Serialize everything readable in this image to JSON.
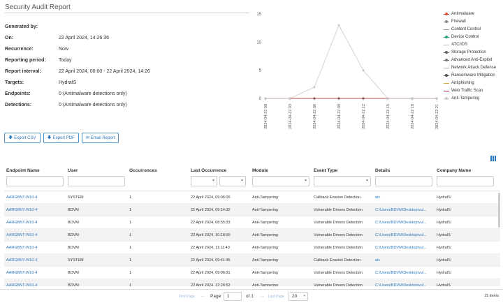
{
  "report": {
    "title": "Security Audit Report",
    "details": [
      {
        "label": "Generated by:",
        "value": ""
      },
      {
        "label": "On:",
        "value": "22 April 2024, 14:26:36"
      },
      {
        "label": "Recurrence:",
        "value": "Now"
      },
      {
        "label": "Reporting period:",
        "value": "Today"
      },
      {
        "label": "Report interval:",
        "value": "22 April 2024, 00:00 - 22 April 2024, 14:26"
      },
      {
        "label": "Targets:",
        "value": "HydraIS"
      },
      {
        "label": "Endpoints:",
        "value": "0 (Antimalware detections only)"
      },
      {
        "label": "Detections:",
        "value": "0 (Antimalware detections only)"
      }
    ]
  },
  "chart_data": {
    "type": "line",
    "x": [
      "2024-04-22 00",
      "2024-04-22 03",
      "2024-04-22 06",
      "2024-04-22 09",
      "2024-04-22 12",
      "2024-04-22 15",
      "2024-04-22 18",
      "2024-04-22 21"
    ],
    "ylim": [
      0,
      15
    ],
    "yticks": [
      0,
      5,
      10,
      15
    ],
    "grid": false,
    "legend_position": "right",
    "series": [
      {
        "name": "Antimalware",
        "color": "#e05030",
        "marker": true,
        "values": [
          0,
          0,
          0,
          0,
          0,
          0,
          0,
          0
        ]
      },
      {
        "name": "Firewall",
        "color": "#888888",
        "marker": true,
        "values": [
          0,
          0,
          0,
          0,
          0,
          0,
          0,
          0
        ]
      },
      {
        "name": "Content Control",
        "color": "#999999",
        "marker": false,
        "values": [
          0,
          0,
          0,
          0,
          0,
          0,
          0,
          0
        ]
      },
      {
        "name": "Device Control",
        "color": "#2aa070",
        "marker": true,
        "values": [
          0,
          0,
          0,
          0,
          0,
          0,
          0,
          0
        ]
      },
      {
        "name": "ATC/IDS",
        "color": "#bbbbbb",
        "marker": false,
        "values": [
          0,
          0,
          0,
          0,
          0,
          0,
          0,
          0
        ]
      },
      {
        "name": "Storage Protection",
        "color": "#666666",
        "marker": true,
        "values": [
          0,
          0,
          0,
          0,
          0,
          0,
          0,
          0
        ]
      },
      {
        "name": "Advanced Anti-Exploit",
        "color": "#777777",
        "marker": true,
        "values": [
          0,
          0,
          0,
          0,
          0,
          0,
          0,
          0
        ]
      },
      {
        "name": "Network Attack Defense",
        "color": "#aaaaaa",
        "marker": false,
        "values": [
          0,
          0,
          0,
          0,
          0,
          0,
          0,
          0
        ]
      },
      {
        "name": "Ransomware Mitigation",
        "color": "#555555",
        "marker": true,
        "values": [
          0,
          0,
          0,
          0,
          0,
          0,
          0,
          0
        ]
      },
      {
        "name": "Antiphishing",
        "color": "#d4b040",
        "marker": false,
        "values": [
          0,
          0,
          0,
          0,
          0,
          0,
          0,
          0
        ]
      },
      {
        "name": "Web Traffic Scan",
        "color": "#c03050",
        "marker": false,
        "values": [
          0,
          0,
          0,
          0,
          0,
          0,
          0,
          0
        ]
      },
      {
        "name": "Anti-Tampering",
        "color": "#c8c8c8",
        "marker": true,
        "values": [
          0,
          0,
          2,
          13,
          5,
          0,
          0,
          0
        ]
      }
    ]
  },
  "actions": {
    "export_csv": "Export CSV",
    "export_pdf": "Export PDF",
    "email_report": "Email Report"
  },
  "table": {
    "columns": [
      "Endpoint Name",
      "User",
      "Occurrences",
      "Last Occurrence",
      "Module",
      "Event Type",
      "Details",
      "Company Name"
    ],
    "rows": [
      [
        "AARGBNT-W10-4",
        "SYSTEM",
        "1",
        "22 April 2024, 09:06:00",
        "Anti-Tampering",
        "Callback Evasion Detection",
        "atc",
        "HydraIS"
      ],
      [
        "AARGBNT-W10-4",
        "BDVM",
        "1",
        "22 April 2024, 09:14:32",
        "Anti-Tampering",
        "Vulnerable Drivers Detection",
        "C:\\Users\\BDVM\\Desktop\\vul...",
        "HydraIS"
      ],
      [
        "AARGBNT-W10-4",
        "BDVM",
        "1",
        "22 April 2024, 08:55:33",
        "Anti-Tampering",
        "Vulnerable Drivers Detection",
        "C:\\Users\\BDVM\\Desktop\\vul...",
        "HydraIS"
      ],
      [
        "AARGBNT-W10-4",
        "BDVM",
        "1",
        "22 April 2024, 10:18:00",
        "Anti-Tampering",
        "Vulnerable Drivers Detection",
        "C:\\Users\\BDVM\\Desktop\\vul...",
        "HydraIS"
      ],
      [
        "AARGBNT-W10-4",
        "BDVM",
        "1",
        "22 April 2024, 11:11:40",
        "Anti-Tampering",
        "Vulnerable Drivers Detection",
        "C:\\Users\\BDVM\\Desktop\\vul...",
        "HydraIS"
      ],
      [
        "AARGBNT-W10-4",
        "SYSTEM",
        "1",
        "22 April 2024, 09:41:35",
        "Anti-Tampering",
        "Callback Evasion Detection",
        "atc",
        "HydraIS"
      ],
      [
        "AARGBNT-W10-4",
        "BDVM",
        "1",
        "22 April 2024, 09:06:31",
        "Anti-Tampering",
        "Vulnerable Drivers Detection",
        "C:\\Users\\BDVM\\Desktop\\vul...",
        "HydraIS"
      ],
      [
        "AARGBNT-W10-4",
        "BDVM",
        "1",
        "22 April 2024, 12:26:52",
        "Anti-Tampering",
        "Vulnerable Drivers Detection",
        "C:\\Users\\BDVM\\Desktop\\vul...",
        "HydraIS"
      ]
    ]
  },
  "pager": {
    "first": "First Page",
    "page_label": "Page",
    "page": "1",
    "of": "of 1",
    "last": "Last Page",
    "page_size": "20",
    "count": "15 items"
  },
  "colors": {
    "accent": "#2a77c0",
    "row_alt": "#f3f3f3"
  }
}
